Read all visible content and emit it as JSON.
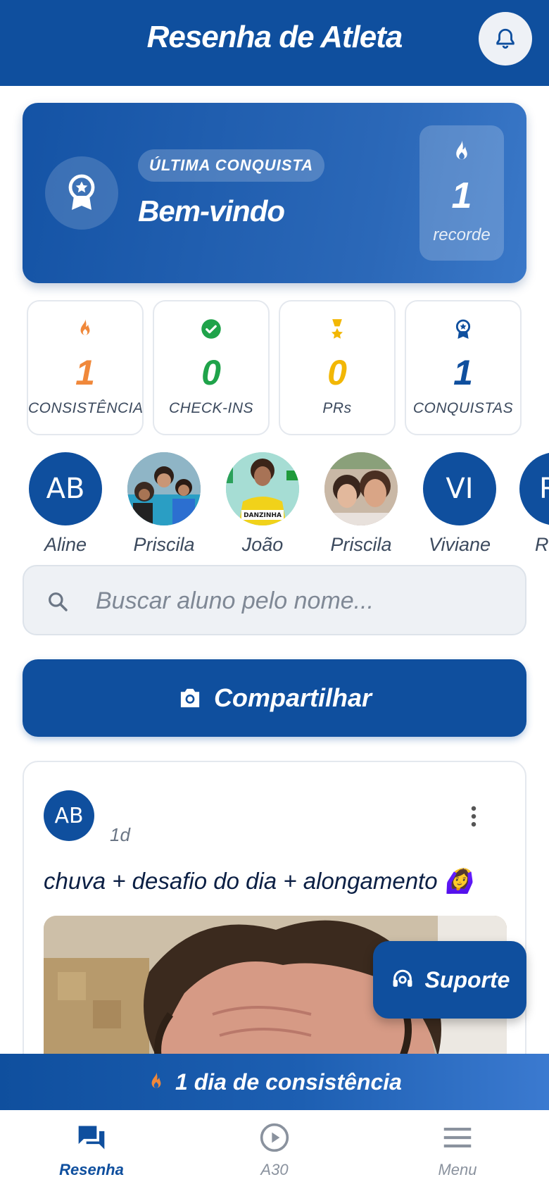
{
  "header": {
    "title": "Resenha de Atleta"
  },
  "achievement": {
    "pill_label": "ÚLTIMA CONQUISTA",
    "title": "Bem-vindo",
    "record_value": "1",
    "record_label": "recorde"
  },
  "stats": [
    {
      "value": "1",
      "label": "CONSISTÊNCIA",
      "color": "#f0883a",
      "icon": "flame-icon"
    },
    {
      "value": "0",
      "label": "CHECK-INS",
      "color": "#1fa34a",
      "icon": "check-circle-icon"
    },
    {
      "value": "0",
      "label": "PRs",
      "color": "#f2b705",
      "icon": "medal-icon"
    },
    {
      "value": "1",
      "label": "CONQUISTAS",
      "color": "#0f4f9e",
      "icon": "award-icon"
    }
  ],
  "stories": [
    {
      "initials": "AB",
      "name": "Aline"
    },
    {
      "initials": "",
      "name": "Priscila"
    },
    {
      "initials": "",
      "name": "João"
    },
    {
      "initials": "",
      "name": "Priscila"
    },
    {
      "initials": "VI",
      "name": "Viviane"
    },
    {
      "initials": "R",
      "name": "Ra"
    }
  ],
  "story_photo_texts": {
    "joao_shirt": "DANZINHA"
  },
  "search": {
    "placeholder": "Buscar aluno pelo nome..."
  },
  "share": {
    "label": "Compartilhar"
  },
  "post": {
    "author_initials": "AB",
    "time": "1d",
    "text": "chuva + desafio do dia + alongamento 🙆‍♀️"
  },
  "support": {
    "label": "Suporte"
  },
  "streak": {
    "text": "1 dia de consistência"
  },
  "nav": [
    {
      "label": "Resenha",
      "icon": "chat-icon",
      "active": true
    },
    {
      "label": "A30",
      "icon": "play-circle-icon",
      "active": false
    },
    {
      "label": "Menu",
      "icon": "hamburger-icon",
      "active": false
    }
  ],
  "colors": {
    "primary": "#0f4f9e",
    "orange": "#f0883a",
    "green": "#1fa34a",
    "gold": "#f2b705"
  }
}
